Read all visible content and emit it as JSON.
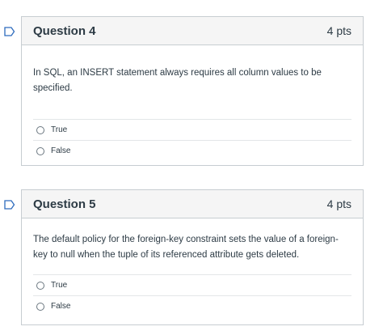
{
  "questions": [
    {
      "title": "Question 4",
      "points": "4 pts",
      "text": "In SQL, an INSERT statement always requires all column values to be specified.",
      "answers": [
        "True",
        "False"
      ]
    },
    {
      "title": "Question 5",
      "points": "4 pts",
      "text": "The default policy for the foreign-key constraint sets the value of a foreign-key to null when the tuple of its referenced attribute gets deleted.",
      "answers": [
        "True",
        "False"
      ]
    }
  ],
  "icons": {
    "flag": "bookmark-flag-icon"
  },
  "colors": {
    "flag": "#2d6bbd",
    "border": "#c7cdd1",
    "header_bg": "#f5f5f5",
    "text": "#2d3b45"
  }
}
